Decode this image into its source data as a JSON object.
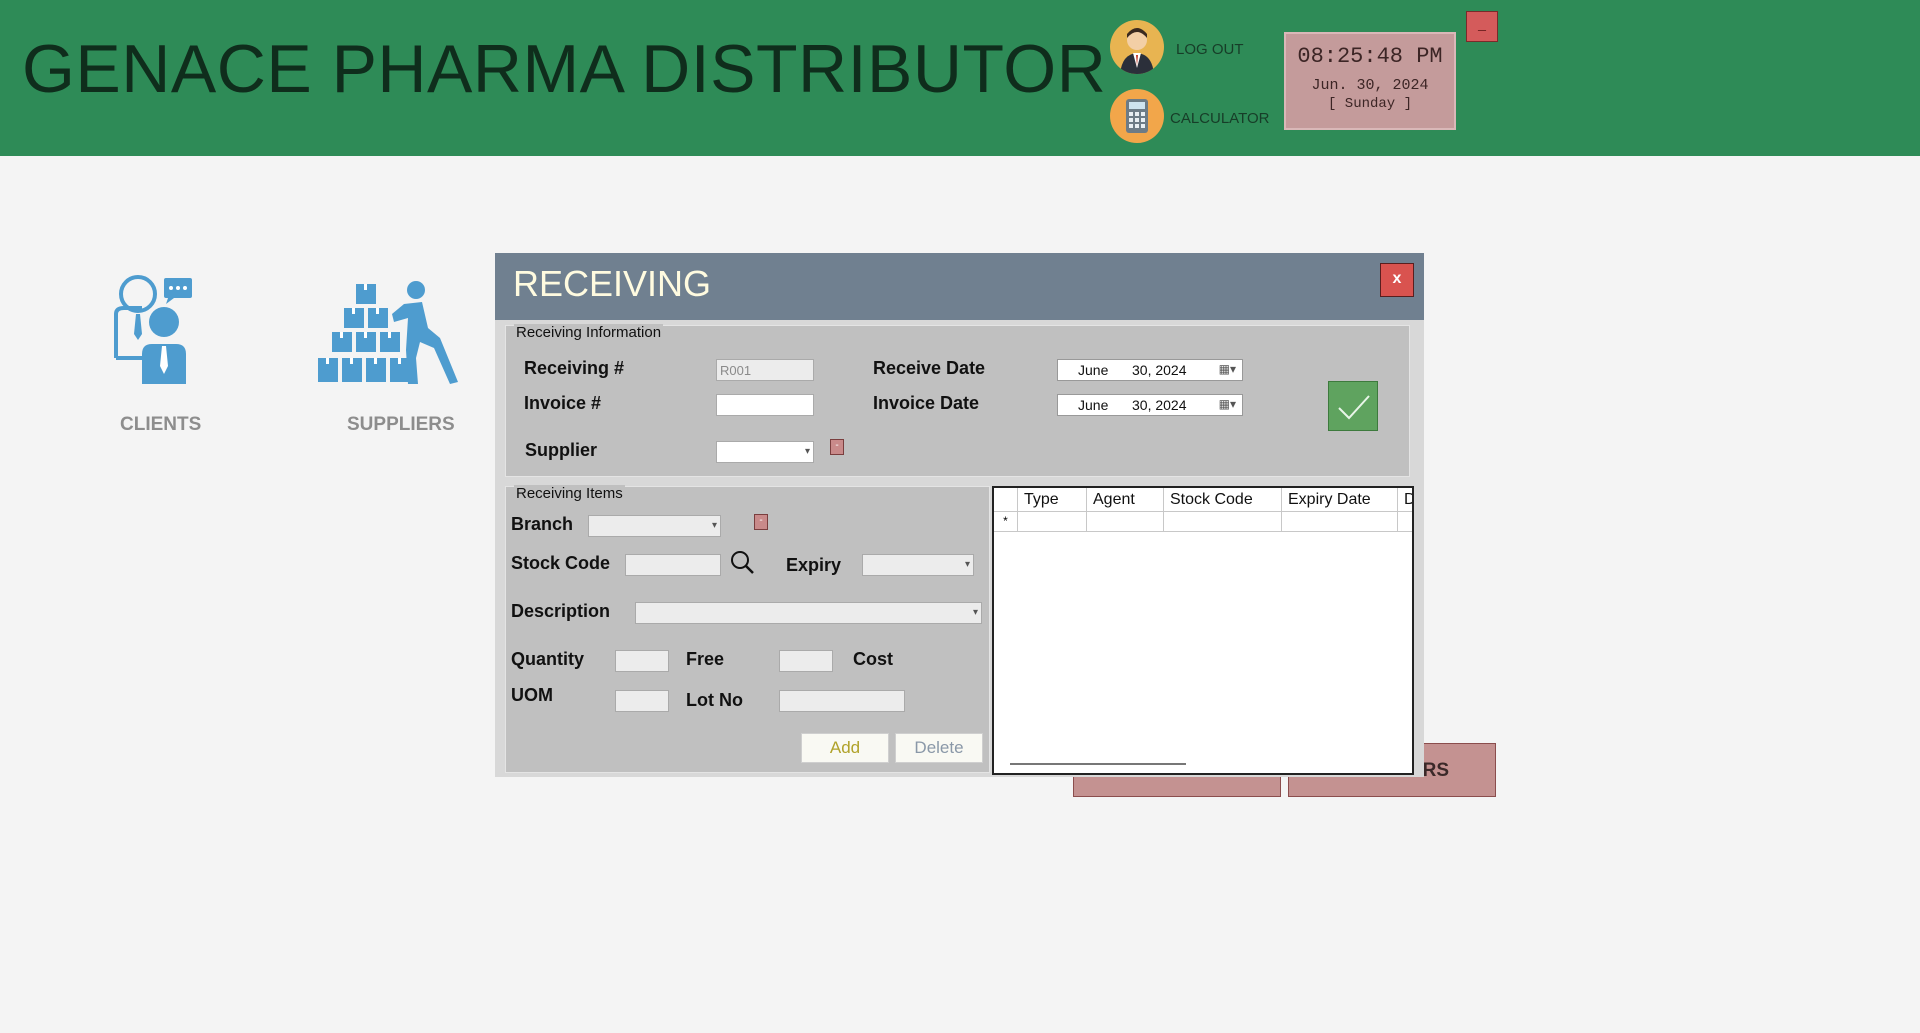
{
  "header": {
    "app_title": "GENACE PHARMA DISTRIBUTOR",
    "logout_label": "LOG OUT",
    "calculator_label": "CALCULATOR",
    "minimize_label": "_",
    "clock": {
      "time": "08:25:48 PM",
      "date": "Jun. 30, 2024",
      "day": "[ Sunday ]"
    },
    "colors": {
      "header_bg": "#2e8b57",
      "title": "#0f2d1c"
    }
  },
  "desktop": {
    "clients_label": "CLIENTS",
    "suppliers_label": "SUPPLIERS",
    "behind_button_visible_text": "RS"
  },
  "receiving": {
    "title": "RECEIVING",
    "close_label": "x",
    "info": {
      "group_title": "Receiving Information",
      "receiving_no_label": "Receiving #",
      "receiving_no_value": "R001",
      "invoice_no_label": "Invoice #",
      "invoice_no_value": "",
      "supplier_label": "Supplier",
      "supplier_value": "",
      "receive_date_label": "Receive Date",
      "receive_date_month": "June",
      "receive_date_day_year": "30, 2024",
      "invoice_date_label": "Invoice Date",
      "invoice_date_month": "June",
      "invoice_date_day_year": "30, 2024",
      "small_button_label": "-"
    },
    "items": {
      "group_title": "Receiving Items",
      "branch_label": "Branch",
      "stock_code_label": "Stock Code",
      "expiry_label": "Expiry",
      "description_label": "Description",
      "quantity_label": "Quantity",
      "free_label": "Free",
      "cost_label": "Cost",
      "uom_label": "UOM",
      "lot_no_label": "Lot No",
      "add_label": "Add",
      "delete_label": "Delete",
      "small_button_label": "-"
    },
    "grid": {
      "columns": [
        "Type",
        "Agent",
        "Stock Code",
        "Expiry Date",
        "D"
      ],
      "new_row_marker": "*"
    }
  },
  "icons": [
    "user-avatar-icon",
    "calculator-icon",
    "clients-icon",
    "suppliers-icon",
    "calendar-icon",
    "checkmark-icon",
    "search-icon"
  ]
}
